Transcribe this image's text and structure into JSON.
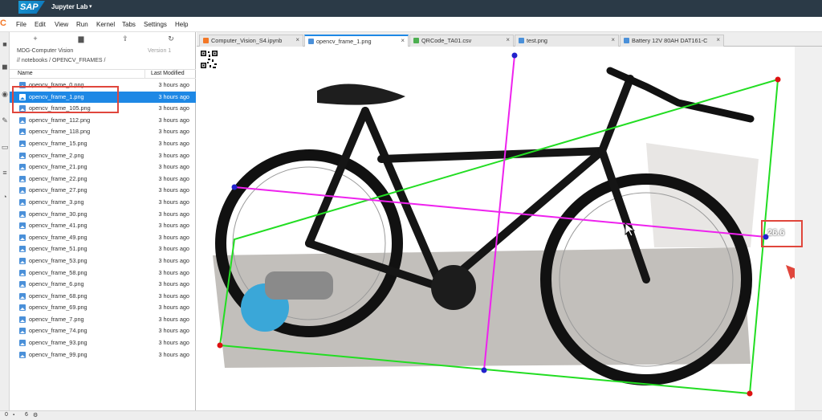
{
  "topbar": {
    "logo": "SAP",
    "title": "Jupyter Lab",
    "caret": "▾"
  },
  "menu": [
    "File",
    "Edit",
    "View",
    "Run",
    "Kernel",
    "Tabs",
    "Settings",
    "Help"
  ],
  "filebrowser": {
    "toolbar": {
      "new": "+",
      "new_folder": "▆",
      "upload": "⇪",
      "refresh": "↻"
    },
    "session": "MDG-Computer Vision",
    "version": "Version 1",
    "breadcrumb": "// notebooks / OPENCV_FRAMES /",
    "col_name": "Name",
    "col_modified": "Last Modified",
    "files": [
      {
        "name": "opencv_frame_0.png",
        "modified": "3 hours ago"
      },
      {
        "name": "opencv_frame_1.png",
        "modified": "3 hours ago",
        "selected": true
      },
      {
        "name": "opencv_frame_105.png",
        "modified": "3 hours ago"
      },
      {
        "name": "opencv_frame_112.png",
        "modified": "3 hours ago"
      },
      {
        "name": "opencv_frame_118.png",
        "modified": "3 hours ago"
      },
      {
        "name": "opencv_frame_15.png",
        "modified": "3 hours ago"
      },
      {
        "name": "opencv_frame_2.png",
        "modified": "3 hours ago"
      },
      {
        "name": "opencv_frame_21.png",
        "modified": "3 hours ago"
      },
      {
        "name": "opencv_frame_22.png",
        "modified": "3 hours ago"
      },
      {
        "name": "opencv_frame_27.png",
        "modified": "3 hours ago"
      },
      {
        "name": "opencv_frame_3.png",
        "modified": "3 hours ago"
      },
      {
        "name": "opencv_frame_30.png",
        "modified": "3 hours ago"
      },
      {
        "name": "opencv_frame_41.png",
        "modified": "3 hours ago"
      },
      {
        "name": "opencv_frame_49.png",
        "modified": "3 hours ago"
      },
      {
        "name": "opencv_frame_51.png",
        "modified": "3 hours ago"
      },
      {
        "name": "opencv_frame_53.png",
        "modified": "3 hours ago"
      },
      {
        "name": "opencv_frame_58.png",
        "modified": "3 hours ago"
      },
      {
        "name": "opencv_frame_6.png",
        "modified": "3 hours ago"
      },
      {
        "name": "opencv_frame_68.png",
        "modified": "3 hours ago"
      },
      {
        "name": "opencv_frame_69.png",
        "modified": "3 hours ago"
      },
      {
        "name": "opencv_frame_7.png",
        "modified": "3 hours ago"
      },
      {
        "name": "opencv_frame_74.png",
        "modified": "3 hours ago"
      },
      {
        "name": "opencv_frame_93.png",
        "modified": "3 hours ago"
      },
      {
        "name": "opencv_frame_99.png",
        "modified": "3 hours ago"
      }
    ]
  },
  "tabs": [
    {
      "label": "Computer_Vision_S4.ipynb",
      "icon_color": "#f37726"
    },
    {
      "label": "opencv_frame_1.png",
      "icon_color": "#4a90d9",
      "active": true
    },
    {
      "label": "QRCode_TA01.csv",
      "icon_color": "#4caf50"
    },
    {
      "label": "test.png",
      "icon_color": "#4a90d9"
    },
    {
      "label": "Battery 12V 80AH DAT161-C",
      "icon_color": "#4a90d9"
    }
  ],
  "tab_close": "×",
  "viewer": {
    "value": "26.6"
  },
  "statusbar": {
    "count1": "0",
    "count2": "6"
  },
  "colors": {
    "green": "#22dd22",
    "magenta": "#ee22ee",
    "red_marker": "#dd1111",
    "blue_marker": "#2222cc",
    "highlight": "#e0463c",
    "selection": "#1e88e5"
  }
}
